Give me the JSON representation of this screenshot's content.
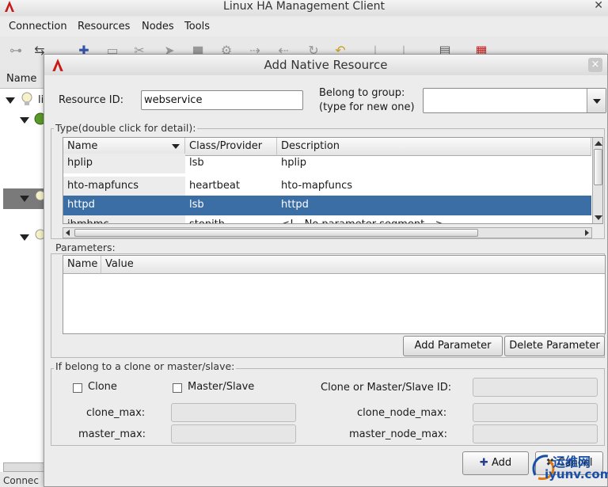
{
  "window": {
    "title": "Linux HA Management Client",
    "close_glyph": "✕"
  },
  "menu": [
    "Connection",
    "Resources",
    "Nodes",
    "Tools"
  ],
  "left_panel": {
    "column_header": "Name",
    "first_node_text": "li",
    "status_text": "Connec"
  },
  "dialog": {
    "title": "Add Native Resource",
    "close_glyph": "×",
    "resource_id_label": "Resource ID:",
    "resource_id_value": "webservice",
    "group_label_line1": "Belong to group:",
    "group_label_line2": "(type for new one)",
    "group_value": "",
    "type_group_title": "Type(double click for detail):",
    "type_table": {
      "columns": [
        "Name",
        "Class/Provider",
        "Description"
      ],
      "rows": [
        {
          "name": "hplip",
          "class": "lsb",
          "description": "hplip"
        },
        {
          "name": "hto-mapfuncs",
          "class": "heartbeat",
          "description": "hto-mapfuncs"
        },
        {
          "name": "httpd",
          "class": "lsb",
          "description": "httpd",
          "selected": true
        },
        {
          "name": "ibmhmc",
          "class": "stonith",
          "description": "<!-- No parameter segment -->"
        }
      ]
    },
    "parameters_group_title": "Parameters:",
    "parameters_table": {
      "columns": [
        "Name",
        "Value"
      ]
    },
    "add_parameter_label": "Add Parameter",
    "delete_parameter_label": "Delete Parameter",
    "clone_group_title": "If belong to a clone or master/slave:",
    "clone_checkbox_label": "Clone",
    "master_slave_checkbox_label": "Master/Slave",
    "clone_ms_id_label": "Clone or Master/Slave ID:",
    "clone_max_label": "clone_max:",
    "clone_node_max_label": "clone_node_max:",
    "master_max_label": "master_max:",
    "master_node_max_label": "master_node_max:",
    "add_button_label": "Add",
    "cancel_button_label": "Cancel"
  },
  "watermark": {
    "line1": "运维网",
    "line2": "iyunv.com"
  },
  "colors": {
    "selection": "#3a6ea5",
    "dialog_bg": "#ececec",
    "app_icon_red": "#c81818"
  }
}
